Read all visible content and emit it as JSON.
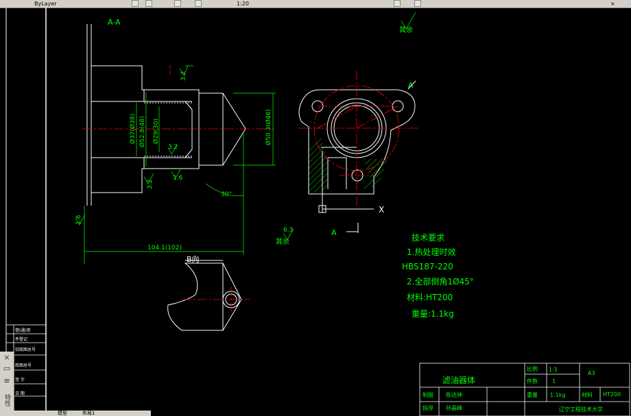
{
  "toolbar": {
    "left_text": "ByLayer",
    "right_text": "1:20",
    "close_glyph": "×",
    "icons": [
      "layer-icon",
      "color-icon",
      "linetype-icon",
      "properties-icon",
      "window-control-icon"
    ]
  },
  "side_panel": {
    "close_glyph": "×",
    "pin_glyph": "▭",
    "props_glyph": "≡",
    "vertical_label": "特性"
  },
  "command_tabs": {
    "model_label": "模型",
    "layout_label": "布局1"
  },
  "drawing": {
    "section_label": "A-A",
    "view_b_label": "B向",
    "view_a_label": "A",
    "arrow_a_label": "A",
    "axis_x_label": "X",
    "roughness_other": "其余",
    "roughness_other_2": "其余",
    "roughness_value": "6.3",
    "dims": {
      "d37": "Ø37(Ø38)",
      "d52": "Ø52.8(48)",
      "d29": "Ø29(30)",
      "d50": "Ø50.3(Ø46)",
      "r32a": "3.2",
      "r32b": "3.2",
      "r32c": "3.2",
      "r16a": "1.6",
      "r16b": "1.6",
      "angle30": "30°",
      "len104": "104.1(102)"
    }
  },
  "tech": {
    "title": "技术要求",
    "line1": "1.热处理时效",
    "line2": "HBS187-220",
    "line3": "2.全部倒角1Ø45°",
    "line4": "材料:HT200",
    "line5": "重量:1.1kg"
  },
  "title_block": {
    "part_name": "滤油器体",
    "scale_label": "比例",
    "scale_value": "1:1",
    "qty_label": "件数",
    "qty_value": "1",
    "sheet": "A3",
    "weight_label": "重量",
    "weight_value": "1.1kg",
    "material_label": "材料",
    "material_value": "HT200",
    "drawn_label": "制图",
    "drawn_name": "陈达钟",
    "checked_label": "指导",
    "checked_name": "孙晶峰",
    "school": "辽宁工程技术大学"
  },
  "left_block": {
    "row1": "借(通)用",
    "row2": "件登记",
    "row3": "旧底图总号",
    "row4": "底图总号",
    "row5": "签  字",
    "row6": "日  期"
  },
  "colors": {
    "background": "#000000",
    "outline": "#ffffff",
    "center_line": "#ff0000",
    "dimension": "#00ff00",
    "hatch": "#00ff00",
    "ui_face": "#d4d0c8"
  }
}
